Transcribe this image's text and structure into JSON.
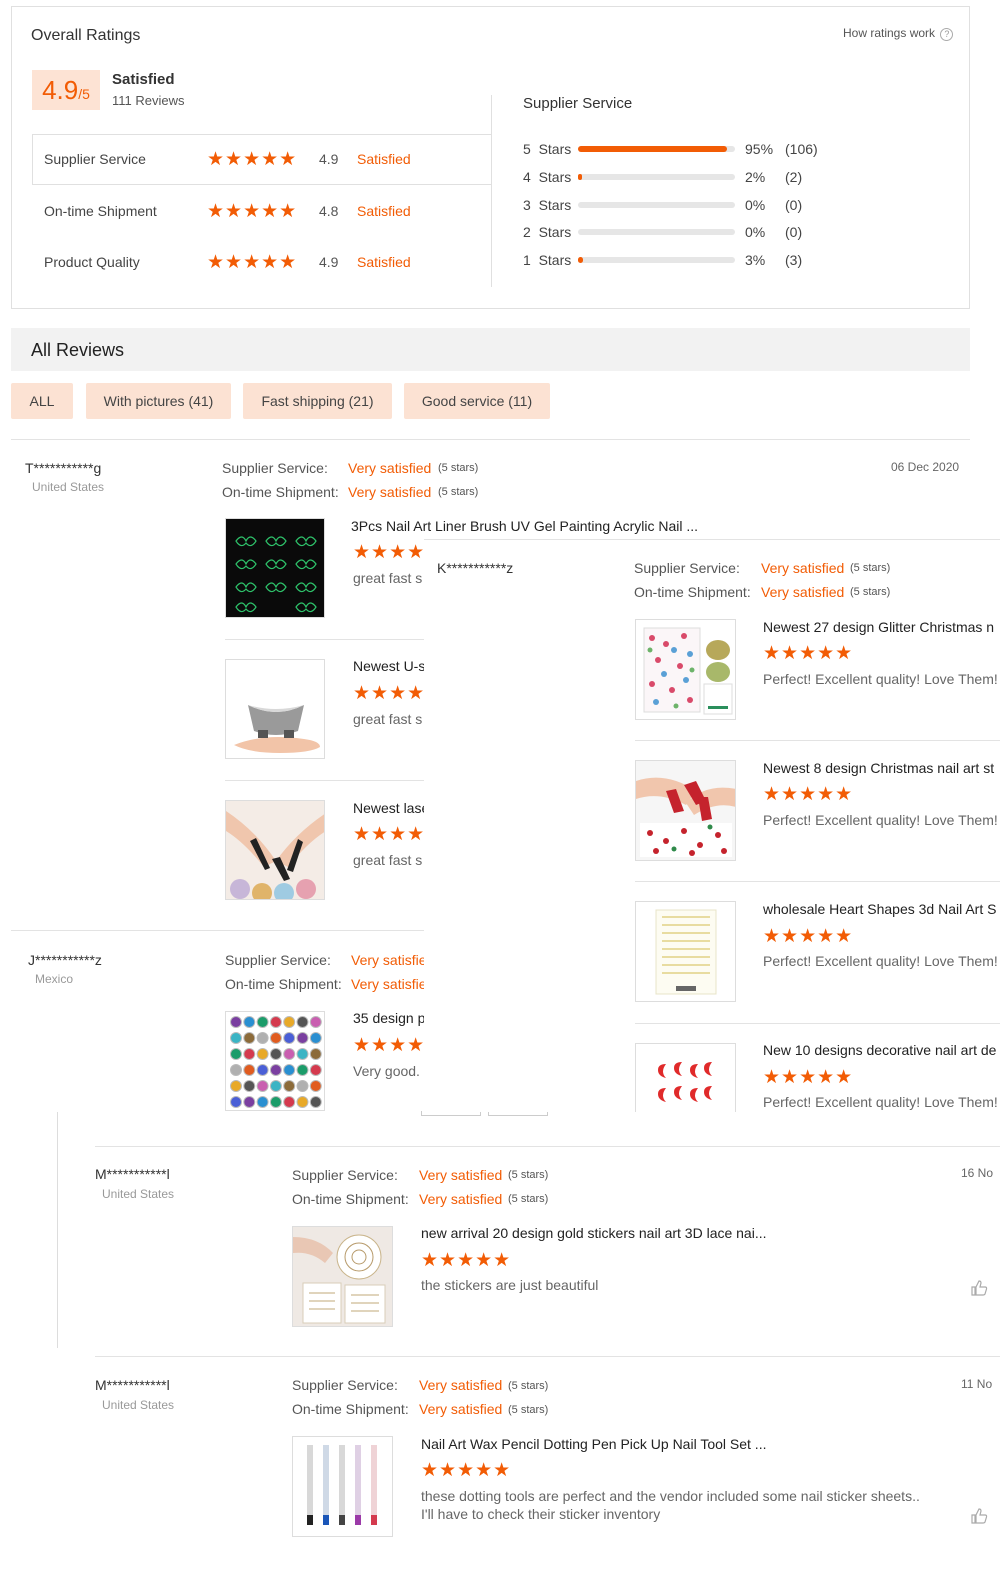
{
  "colors": {
    "accent": "#f25c05",
    "chip_bg": "#fce2d3",
    "header_bg": "#f2f2f2"
  },
  "overall": {
    "title": "Overall Ratings",
    "how_link": "How ratings work",
    "score": "4.9",
    "score_unit": "/5",
    "label": "Satisfied",
    "reviews": "111 Reviews",
    "rows": [
      {
        "name": "Supplier Service",
        "score": "4.9",
        "status": "Satisfied"
      },
      {
        "name": "On-time Shipment",
        "score": "4.8",
        "status": "Satisfied"
      },
      {
        "name": "Product Quality",
        "score": "4.9",
        "status": "Satisfied"
      }
    ],
    "breakdown_title": "Supplier Service",
    "breakdown": [
      {
        "label": "5  Stars",
        "pct": "95%",
        "count": "(106)",
        "fill": 0.95
      },
      {
        "label": "4  Stars",
        "pct": "2%",
        "count": "(2)",
        "fill": 0.02
      },
      {
        "label": "3  Stars",
        "pct": "0%",
        "count": "(0)",
        "fill": 0
      },
      {
        "label": "2  Stars",
        "pct": "0%",
        "count": "(0)",
        "fill": 0
      },
      {
        "label": "1  Stars",
        "pct": "3%",
        "count": "(3)",
        "fill": 0.03
      }
    ]
  },
  "all_reviews": {
    "title": "All Reviews",
    "filters": [
      "ALL",
      "With pictures (41)",
      "Fast shipping (21)",
      "Good service (11)"
    ]
  },
  "labels": {
    "supplier_service": "Supplier Service:",
    "ontime": "On-time Shipment:",
    "very_satisfied": "Very satisfied",
    "five_stars": "(5 stars)",
    "stars": "★★★★★"
  },
  "review1": {
    "user": "T***********g",
    "country": "United States",
    "date": "06 Dec 2020",
    "products": [
      {
        "title": "3Pcs Nail Art Liner Brush UV Gel Painting Acrylic Nail ...",
        "comment": "great fast s"
      },
      {
        "title": "Newest U-s",
        "comment": "great fast s"
      },
      {
        "title": "Newest lase",
        "comment": "great fast s"
      }
    ]
  },
  "review2": {
    "user": "J***********z",
    "country": "Mexico",
    "ss_value": "Very satisfie",
    "ot_value": "Very satisfie",
    "product_title": "35 design p",
    "comment": "Very good."
  },
  "review_k": {
    "user": "K***********z",
    "products": [
      {
        "title": "Newest 27 design Glitter Christmas n",
        "comment": "Perfect! Excellent quality! Love Them!"
      },
      {
        "title": "Newest 8 design Christmas nail art st",
        "comment": "Perfect! Excellent quality! Love Them!"
      },
      {
        "title": "wholesale Heart Shapes 3d Nail Art S",
        "comment": "Perfect! Excellent quality! Love Them!"
      },
      {
        "title": "New 10 designs decorative nail art de",
        "comment": "Perfect! Excellent quality! Love Them!"
      }
    ]
  },
  "review3": {
    "user": "M***********l",
    "country": "United States",
    "date": "16 No",
    "title": "new arrival 20 design gold stickers nail art 3D lace nai...",
    "comment": "the stickers are just beautiful"
  },
  "review4": {
    "user": "M***********l",
    "country": "United States",
    "date": "11 No",
    "title": "Nail Art Wax Pencil Dotting Pen Pick Up Nail Tool Set ...",
    "comment1": "these dotting tools are perfect and the vendor included some nail sticker sheets..",
    "comment2": "I'll have to check their sticker inventory"
  }
}
